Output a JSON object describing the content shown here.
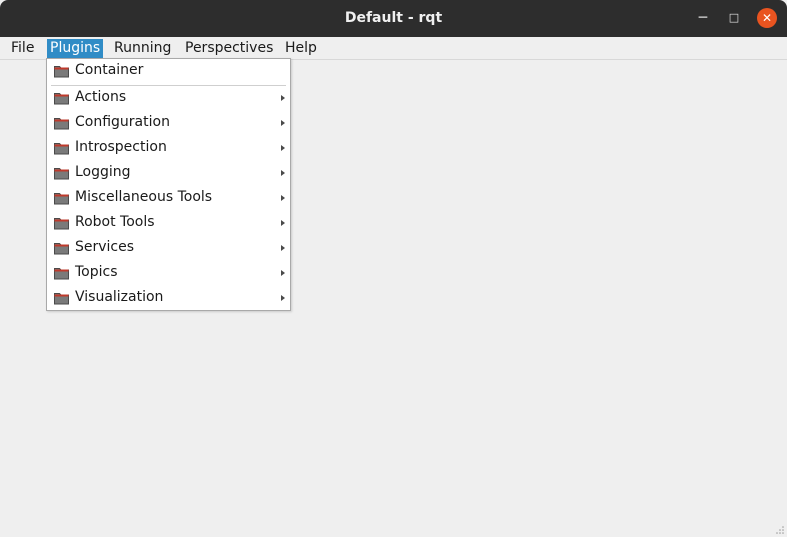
{
  "window": {
    "title": "Default - rqt",
    "minimize_glyph": "─",
    "maximize_glyph": "□",
    "close_glyph": "✕",
    "close_color": "#e95420"
  },
  "menubar": {
    "file": "File",
    "plugins": "Plugins",
    "running": "Running",
    "perspectives": "Perspectives",
    "help": "Help"
  },
  "plugins_menu": {
    "icon": "folder-icon",
    "items": [
      {
        "label": "Container",
        "submenu": false
      },
      {
        "label": "Actions",
        "submenu": true
      },
      {
        "label": "Configuration",
        "submenu": true
      },
      {
        "label": "Introspection",
        "submenu": true
      },
      {
        "label": "Logging",
        "submenu": true
      },
      {
        "label": "Miscellaneous Tools",
        "submenu": true
      },
      {
        "label": "Robot Tools",
        "submenu": true
      },
      {
        "label": "Services",
        "submenu": true
      },
      {
        "label": "Topics",
        "submenu": true
      },
      {
        "label": "Visualization",
        "submenu": true
      }
    ]
  },
  "colors": {
    "titlebar": "#2d2d2d",
    "menu_highlight": "#308cc6",
    "background": "#efefef"
  }
}
